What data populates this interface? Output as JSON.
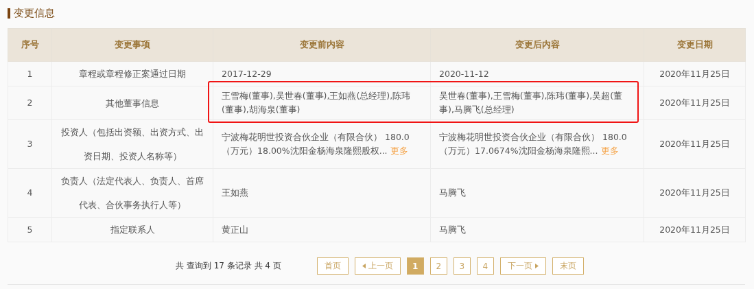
{
  "section": {
    "title": "变更信息"
  },
  "table": {
    "columns": [
      "序号",
      "变更事项",
      "变更前内容",
      "变更后内容",
      "变更日期"
    ],
    "rows": [
      {
        "index": "1",
        "item": "章程或章程修正案通过日期",
        "before": {
          "text": "2017-12-29"
        },
        "after": {
          "text": "2020-11-12"
        },
        "date": "2020年11月25日",
        "highlighted": false
      },
      {
        "index": "2",
        "item": "其他董事信息",
        "before": {
          "text": "王雪梅(董事),吴世春(董事),王如燕(总经理),陈玮(董事),胡海泉(董事)"
        },
        "after": {
          "text": "吴世春(董事),王雪梅(董事),陈玮(董事),吴超(董事),马腾飞(总经理)"
        },
        "date": "2020年11月25日",
        "highlighted": true
      },
      {
        "index": "3",
        "item": "投资人（包括出资额、出资方式、出资日期、投资人名称等）",
        "before": {
          "text": "宁波梅花明世投资合伙企业（有限合伙） 180.0（万元）18.00%沈阳金杨海泉隆熙股权...",
          "more": "更多"
        },
        "after": {
          "text": "宁波梅花明世投资合伙企业（有限合伙） 180.0（万元）17.0674%沈阳金杨海泉隆熙...",
          "more": "更多"
        },
        "date": "2020年11月25日",
        "highlighted": false
      },
      {
        "index": "4",
        "item": "负责人（法定代表人、负责人、首席代表、合伙事务执行人等）",
        "before": {
          "text": "王如燕"
        },
        "after": {
          "text": "马腾飞"
        },
        "date": "2020年11月25日",
        "highlighted": false
      },
      {
        "index": "5",
        "item": "指定联系人",
        "before": {
          "text": "黄正山"
        },
        "after": {
          "text": "马腾飞"
        },
        "date": "2020年11月25日",
        "highlighted": false
      }
    ]
  },
  "pagination": {
    "summary": "共 查询到 17 条记录 共 4 页",
    "buttons": [
      {
        "kind": "first",
        "label": "首页",
        "selected": false
      },
      {
        "kind": "prev",
        "label": "上一页",
        "selected": false
      },
      {
        "kind": "page",
        "label": "1",
        "selected": true
      },
      {
        "kind": "page",
        "label": "2",
        "selected": false
      },
      {
        "kind": "page",
        "label": "3",
        "selected": false
      },
      {
        "kind": "page",
        "label": "4",
        "selected": false
      },
      {
        "kind": "next",
        "label": "下一页",
        "selected": false
      },
      {
        "kind": "last",
        "label": "末页",
        "selected": false
      }
    ]
  }
}
